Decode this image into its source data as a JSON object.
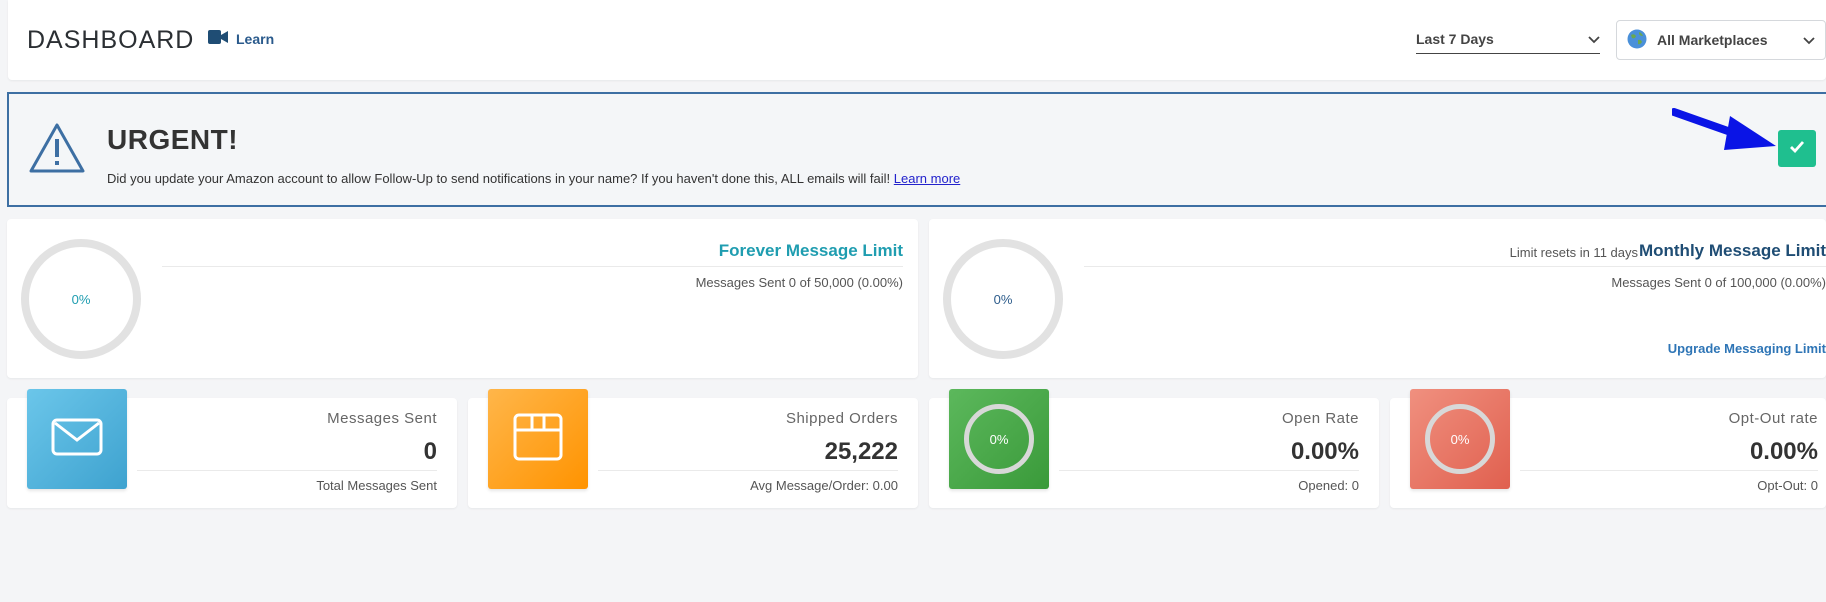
{
  "header": {
    "title": "DASHBOARD",
    "learn_label": "Learn",
    "date_range": "Last 7 Days",
    "marketplace": "All Marketplaces"
  },
  "urgent": {
    "title": "URGENT!",
    "message": "Did you update your Amazon account to allow Follow-Up to send notifications in your name? If you haven't done this, ALL emails will fail!",
    "link_text": "Learn more"
  },
  "limits": {
    "forever": {
      "percent": "0%",
      "title": "Forever Message Limit",
      "sent": "Messages Sent 0 of 50,000 (0.00%)"
    },
    "monthly": {
      "percent": "0%",
      "reset": "Limit resets in 11 days",
      "title": "Monthly Message Limit",
      "sent": "Messages Sent 0 of 100,000 (0.00%)",
      "upgrade": "Upgrade Messaging Limit"
    }
  },
  "stats": {
    "messages_sent": {
      "label": "Messages Sent",
      "value": "0",
      "sub": "Total Messages Sent"
    },
    "shipped_orders": {
      "label": "Shipped Orders",
      "value": "25,222",
      "sub": "Avg Message/Order: 0.00"
    },
    "open_rate": {
      "label": "Open Rate",
      "value": "0.00%",
      "sub": "Opened: 0",
      "ring": "0%"
    },
    "opt_out": {
      "label": "Opt-Out rate",
      "value": "0.00%",
      "sub": "Opt-Out: 0",
      "ring": "0%"
    }
  },
  "colors": {
    "accent_teal": "#1f9db0",
    "accent_navy": "#1f4d74",
    "confirm_green": "#1fbf8f",
    "urgent_border": "#3d6fa3"
  }
}
